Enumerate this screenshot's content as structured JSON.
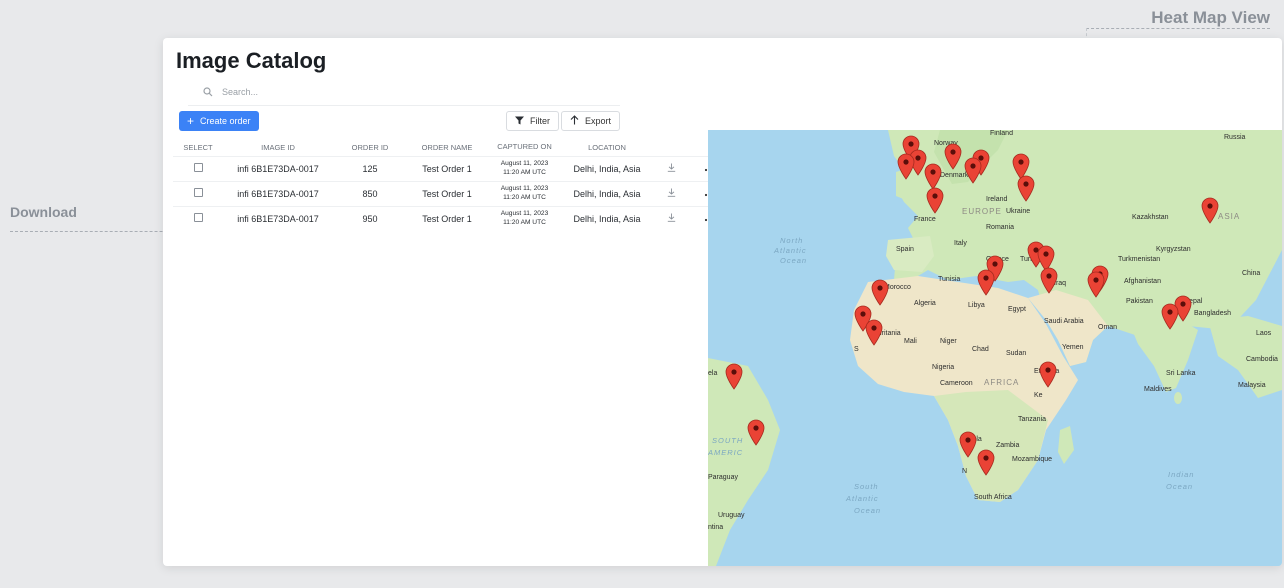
{
  "annotations": {
    "heat_map_view": "Heat Map View",
    "download": "Download"
  },
  "page": {
    "title": "Image Catalog",
    "search_placeholder": "Search...",
    "create_order_label": "Create order",
    "filter_label": "Filter",
    "export_label": "Export"
  },
  "table": {
    "headers": {
      "select": "SELECT",
      "image_id": "IMAGE ID",
      "order_id": "ORDER ID",
      "order_name": "ORDER NAME",
      "captured_on": "CAPTURED ON",
      "location": "LOCATION"
    },
    "rows": [
      {
        "image_id": "infi 6B1E73DA-0017",
        "order_id": "125",
        "order_name": "Test Order 1",
        "captured_date": "August 11, 2023",
        "captured_time": "11:20 AM UTC",
        "location": "Delhi, India, Asia"
      },
      {
        "image_id": "infi 6B1E73DA-0017",
        "order_id": "850",
        "order_name": "Test Order 1",
        "captured_date": "August 11, 2023",
        "captured_time": "11:20 AM UTC",
        "location": "Delhi, India, Asia"
      },
      {
        "image_id": "infi 6B1E73DA-0017",
        "order_id": "950",
        "order_name": "Test Order 1",
        "captured_date": "August 11, 2023",
        "captured_time": "11:20 AM UTC",
        "location": "Delhi, India, Asia"
      }
    ]
  },
  "map": {
    "labels": {
      "finland": "Finland",
      "russia": "Russia",
      "norway": "Norway",
      "denmark": "Denmark",
      "ireland": "Ireland",
      "europe": "EUROPE",
      "ukraine": "Ukraine",
      "france": "France",
      "romania": "Romania",
      "kazakhstan": "Kazakhstan",
      "asia": "ASIA",
      "north": "North",
      "atlantic": "Atlantic",
      "ocean": "Ocean",
      "spain": "Spain",
      "italy": "Italy",
      "kyrgyzstan": "Kyrgyzstan",
      "greece": "Greece",
      "turkey": "Turkey",
      "turkmenistan": "Turkmenistan",
      "china": "China",
      "tunisia": "Tunisia",
      "morocco": "Morocco",
      "iraq": "Iraq",
      "afghanistan": "Afghanistan",
      "algeria": "Algeria",
      "libya": "Libya",
      "egypt": "Egypt",
      "pakistan": "Pakistan",
      "nepal": "Nepal",
      "saudi_arabia": "Saudi Arabia",
      "bangladesh": "Bangladesh",
      "oman": "Oman",
      "mauritania": "Mauritania",
      "laos": "Laos",
      "mali": "Mali",
      "niger": "Niger",
      "chad": "Chad",
      "yemen": "Yemen",
      "sudan": "Sudan",
      "senegal": "S",
      "cambodia": "Cambodia",
      "nigeria": "Nigeria",
      "ethiopia": "Ethiopia",
      "sri_lanka": "Sri Lanka",
      "venezuela": "ela",
      "cameroon": "Cameroon",
      "africa": "AFRICA",
      "malaysia": "Malaysia",
      "kenya": "Ke",
      "maldives": "Maldives",
      "tanzania": "Tanzania",
      "south": "SOUTH",
      "america": "AMERIC",
      "angola": "Angola",
      "zambia": "Zambia",
      "mozambique": "Mozambique",
      "paraguay": "Paraguay",
      "indian": "Indian",
      "indian_ocean": "Ocean",
      "south_atlantic_1": "South",
      "south_atlantic_2": "Atlantic",
      "south_atlantic_3": "Ocean",
      "namibia": "N",
      "uruguay": "Uruguay",
      "south_africa": "South Africa",
      "argentina": "ntina"
    },
    "marker_icon": "map-pin-icon",
    "marker_color": "#ea4335"
  },
  "colors": {
    "accent": "#3b82f6",
    "water": "#a7d5ee",
    "land": "#cfe8b8",
    "desert": "#efe6c9"
  },
  "icons": {
    "search": "search-icon",
    "plus": "plus-icon",
    "filter": "filter-icon",
    "export": "arrow-up-icon",
    "download": "download-icon",
    "more": "more-horizontal-icon"
  }
}
